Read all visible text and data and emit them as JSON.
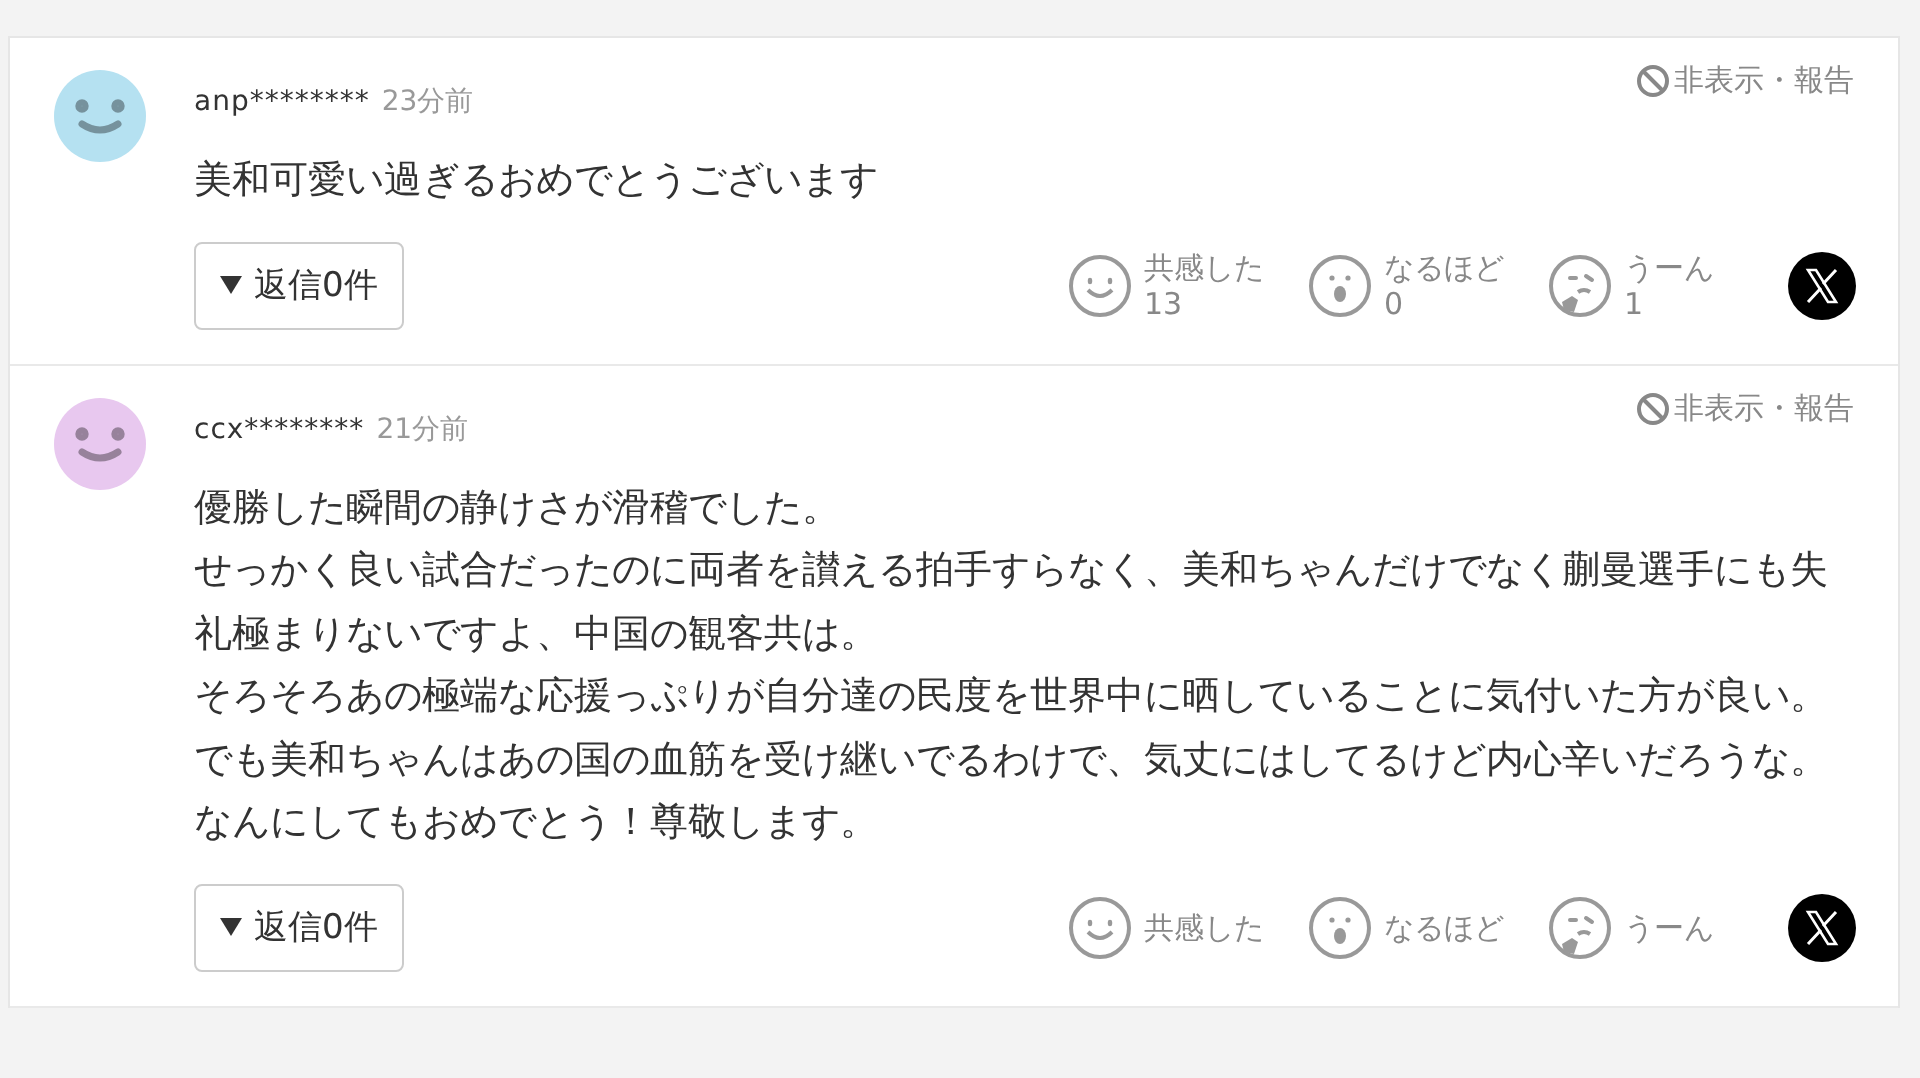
{
  "comments": [
    {
      "user": "anp********",
      "time": "23分前",
      "color": "#b5e1f1",
      "report": "非表示・報告",
      "body": [
        "美和可愛い過ぎるおめでとうございます"
      ],
      "replies": "返信0件",
      "reactions": [
        {
          "kind": "smile",
          "label": "共感した",
          "count": "13"
        },
        {
          "kind": "surprise",
          "label": "なるほど",
          "count": "0"
        },
        {
          "kind": "think",
          "label": "うーん",
          "count": "1"
        }
      ]
    },
    {
      "user": "ccx********",
      "time": "21分前",
      "color": "#e8c8ef",
      "report": "非表示・報告",
      "body": [
        "優勝した瞬間の静けさが滑稽でした。",
        "せっかく良い試合だったのに両者を讃える拍手すらなく、美和ちゃんだけでなく蒯曼選手にも失礼極まりないですよ、中国の観客共は。",
        "そろそろあの極端な応援っぷりが自分達の民度を世界中に晒していることに気付いた方が良い。",
        "でも美和ちゃんはあの国の血筋を受け継いでるわけで、気丈にはしてるけど内心辛いだろうな。",
        "なんにしてもおめでとう！尊敬します。"
      ],
      "replies": "返信0件",
      "reactions": [
        {
          "kind": "smile",
          "label": "共感した"
        },
        {
          "kind": "surprise",
          "label": "なるほど"
        },
        {
          "kind": "think",
          "label": "うーん"
        }
      ]
    }
  ]
}
